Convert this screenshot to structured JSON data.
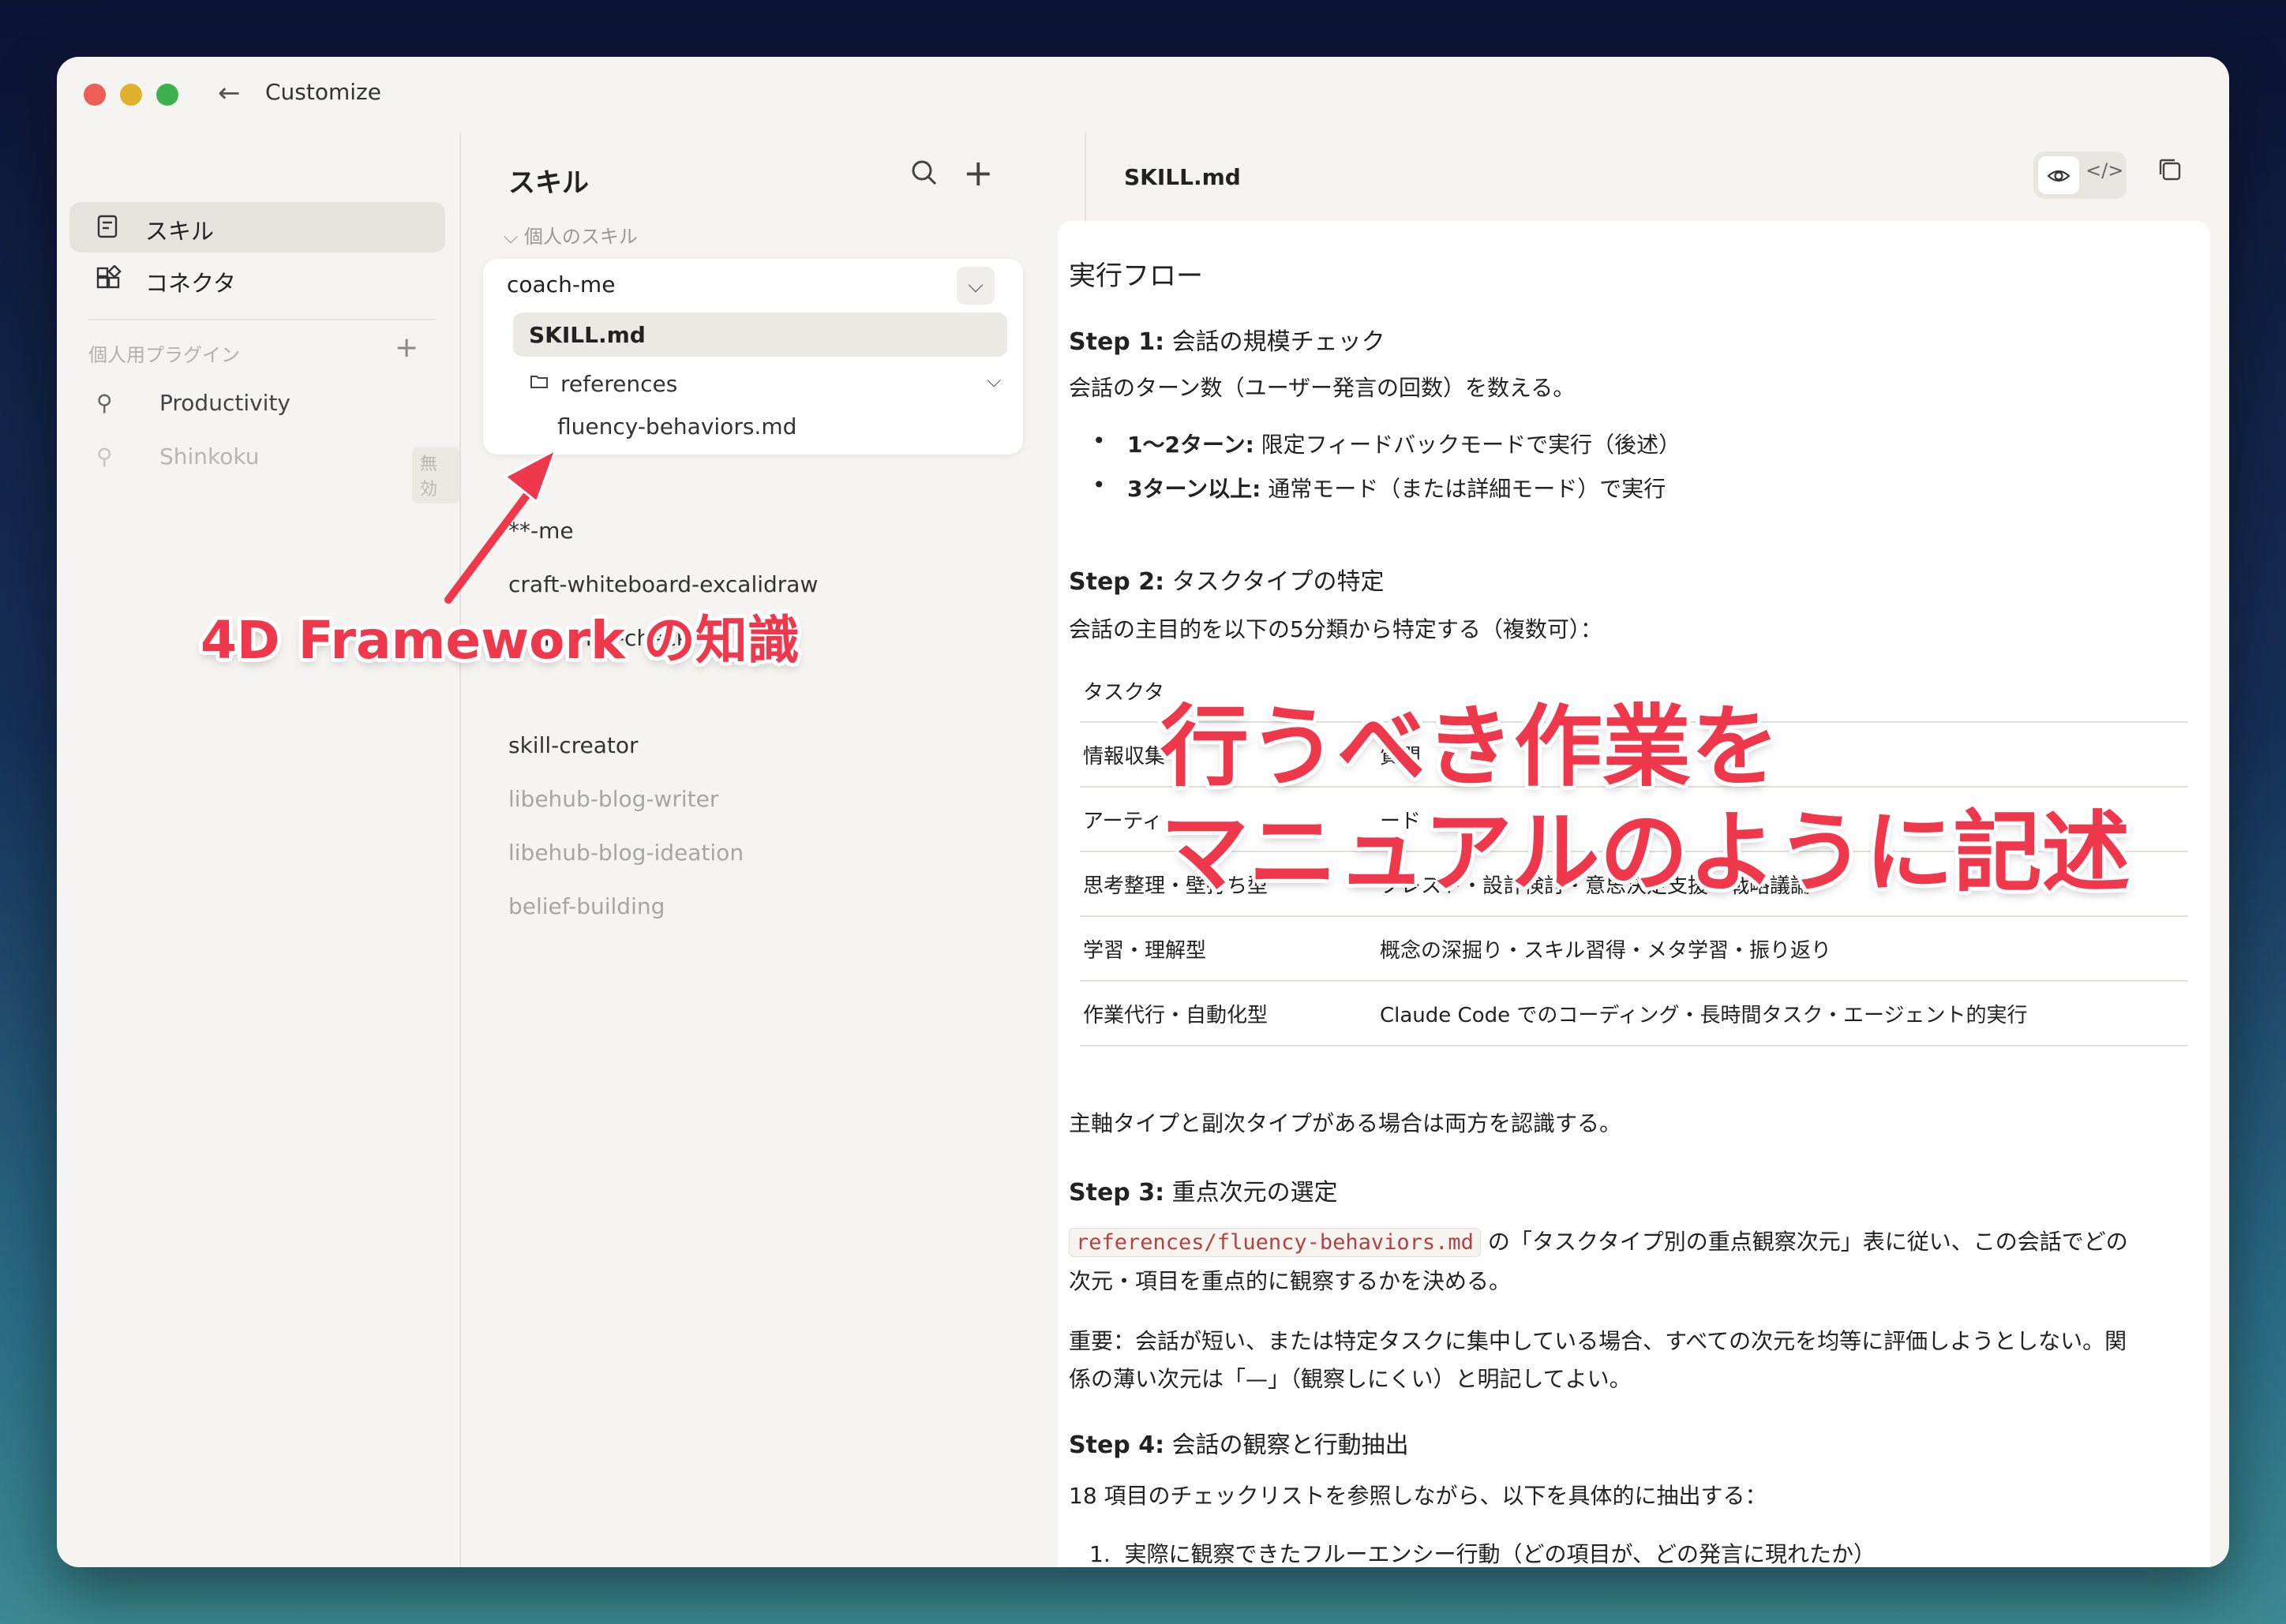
{
  "window": {
    "title": "Customize"
  },
  "sidebar": {
    "items": [
      {
        "label": "スキル",
        "icon": "skill-icon",
        "active": true
      },
      {
        "label": "コネクタ",
        "icon": "connector-icon",
        "active": false
      }
    ],
    "section_label": "個人用プラグイン",
    "plugins": [
      {
        "label": "Productivity",
        "icon": "plug-icon",
        "enabled": true
      },
      {
        "label": "Shinkoku",
        "icon": "plug-icon",
        "enabled": false,
        "badge": "無効"
      }
    ]
  },
  "skills_panel": {
    "title": "スキル",
    "section": "個人のスキル",
    "expanded": {
      "name": "coach-me",
      "active_file": "SKILL.md",
      "folder": "references",
      "subfile": "fluency-behaviors.md"
    },
    "items": [
      {
        "label": "**-me",
        "dim": false
      },
      {
        "label": "craft-whiteboard-excalidraw",
        "dim": false
      },
      {
        "label": "ai-fluency-check",
        "dim": false
      },
      {
        "label": "skill-creator",
        "dim": false
      },
      {
        "label": "libehub-blog-writer",
        "dim": true
      },
      {
        "label": "libehub-blog-ideation",
        "dim": true
      },
      {
        "label": "belief-building",
        "dim": true
      }
    ]
  },
  "document": {
    "filename": "SKILL.md",
    "heading": "実行フロー",
    "step1": {
      "label": "Step 1:",
      "title": "会話の規模チェック",
      "text": "会話のターン数（ユーザー発言の回数）を数える。",
      "bullets": [
        {
          "strong": "1〜2ターン:",
          "text": "限定フィードバックモードで実行（後述）"
        },
        {
          "strong": "3ターン以上:",
          "text": "通常モード（または詳細モード）で実行"
        }
      ]
    },
    "step2": {
      "label": "Step 2:",
      "title": "タスクタイプの特定",
      "text": "会話の主目的を以下の5分類から特定する（複数可）：",
      "table_header": [
        "タスクタ",
        ""
      ],
      "rows": [
        [
          "情報収集",
          "質問"
        ],
        [
          "アーティ",
          "ード"
        ],
        [
          "思考整理・壁打ち型",
          "ブレスト・設計検討・意思決定支援・戦略議論"
        ],
        [
          "学習・理解型",
          "概念の深掘り・スキル習得・メタ学習・振り返り"
        ],
        [
          "作業代行・自動化型",
          "Claude Code でのコーディング・長時間タスク・エージェント的実行"
        ]
      ],
      "after": "主軸タイプと副次タイプがある場合は両方を認識する。"
    },
    "step3": {
      "label": "Step 3:",
      "title": "重点次元の選定",
      "code": "references/fluency-behaviors.md",
      "text1": "の「タスクタイプ別の重点観察次元」表に従い、この会話でどの",
      "text2": "次元・項目を重点的に観察するかを決める。",
      "note1": "重要：会話が短い、または特定タスクに集中している場合、すべての次元を均等に評価しようとしない。関",
      "note2": "係の薄い次元は「—」（観察しにくい）と明記してよい。"
    },
    "step4": {
      "label": "Step 4:",
      "title": "会話の観察と行動抽出",
      "text": "18 項目のチェックリストを参照しながら、以下を具体的に抽出する：",
      "list": [
        {
          "num": "1.",
          "text": "実際に観察できたフルーエンシー行動（どの項目が、どの発言に現れたか）"
        }
      ]
    }
  },
  "annotations": {
    "left": "4D Framework の知識",
    "right_line1": "行うべき作業を",
    "right_line2": "マニュアルのように記述",
    "color": "#f0384c"
  }
}
